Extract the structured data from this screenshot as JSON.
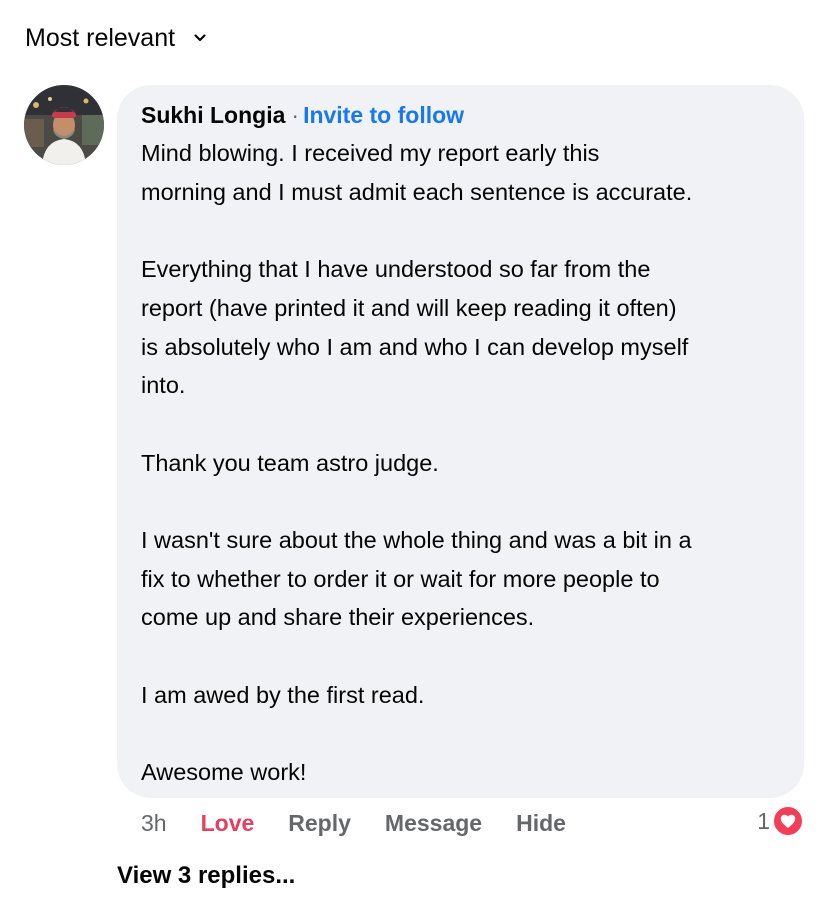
{
  "sort": {
    "label": "Most relevant"
  },
  "comment": {
    "author": "Sukhi Longia",
    "separator": "·",
    "invite_label": "Invite to follow",
    "lines": [
      "Mind blowing. I received my report early this",
      "morning and I must admit each sentence is accurate.",
      "",
      "Everything that I have understood so far from the",
      "report (have printed it and will keep reading it often)",
      "is absolutely who I am and who I can develop myself",
      "into.",
      "",
      "Thank you team astro judge.",
      "",
      "I wasn't sure about the whole thing and was a bit in a",
      "fix to whether to order it or wait for more people to",
      "come up and share their experiences.",
      "",
      "I am awed by the first read.",
      "",
      "Awesome work!"
    ],
    "timestamp": "3h",
    "actions": {
      "love": "Love",
      "reply": "Reply",
      "message": "Message",
      "hide": "Hide"
    },
    "reaction_count": "1",
    "reaction_type": "heart-icon"
  },
  "replies": {
    "label": "View 3 replies..."
  },
  "colors": {
    "accent_link": "#1877f2",
    "love": "#e4405f",
    "bubble_bg": "#f0f2f5",
    "muted": "#65676b"
  }
}
